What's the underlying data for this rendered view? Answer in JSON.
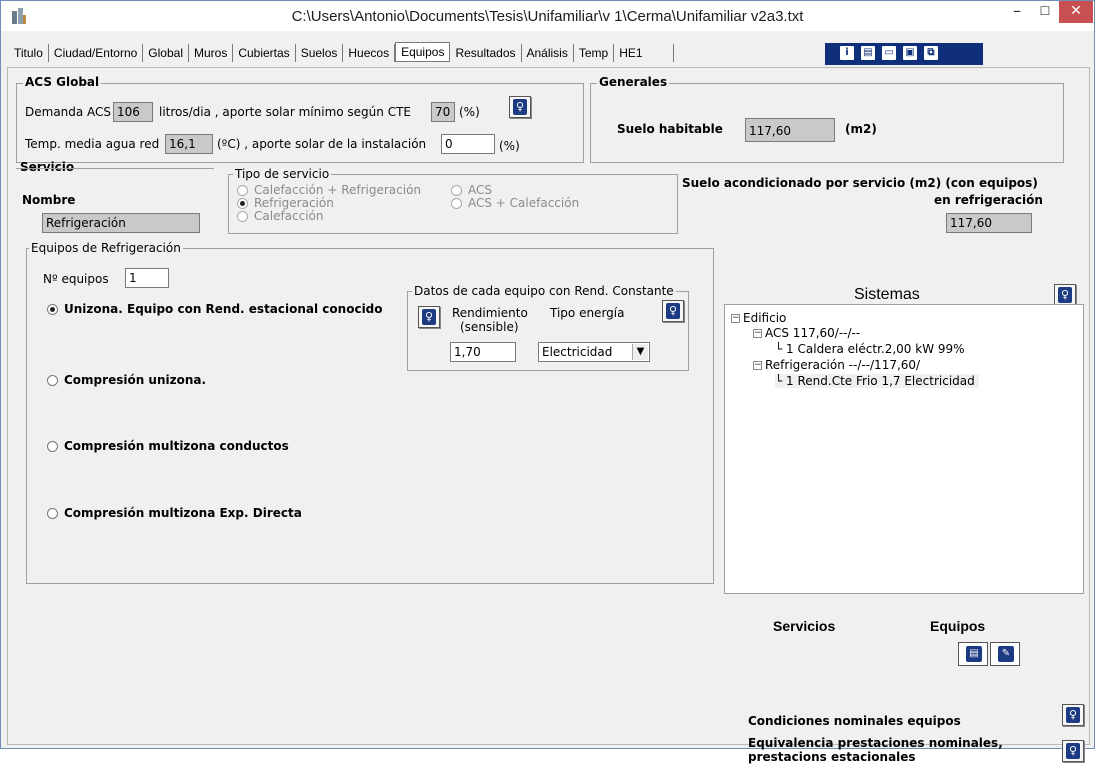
{
  "window": {
    "title": "C:\\Users\\Antonio\\Documents\\Tesis\\Unifamiliar\\v 1\\Cerma\\Unifamiliar v2a3.txt",
    "minimize": "–",
    "maximize": "☐",
    "close": "✕"
  },
  "tabs": [
    {
      "label": "Titulo"
    },
    {
      "label": "Ciudad/Entorno"
    },
    {
      "label": "Global"
    },
    {
      "label": "Muros"
    },
    {
      "label": "Cubiertas"
    },
    {
      "label": "Suelos"
    },
    {
      "label": "Huecos"
    },
    {
      "label": "Equipos"
    },
    {
      "label": "Resultados"
    },
    {
      "label": "Análisis"
    },
    {
      "label": "Temp"
    },
    {
      "label": "HE1"
    }
  ],
  "active_tab": "Equipos",
  "toolbar": {
    "icons": [
      "info-icon",
      "document-icon",
      "folder-open-icon",
      "save-icon",
      "copy-icon"
    ],
    "color": "#0f2f7a"
  },
  "acs_global": {
    "legend": "ACS Global",
    "demanda_label": "Demanda ACS",
    "demanda_value": "106",
    "demanda_unit": "litros/dia , aporte solar mínimo según CTE",
    "aporte_min_value": "70",
    "aporte_min_unit": "(%)",
    "temp_label": "Temp. media agua red",
    "temp_value": "16,1",
    "temp_unit": "(ºC) , aporte solar de la instalación",
    "aporte_inst_value": "0",
    "aporte_inst_unit": "(%)"
  },
  "generales": {
    "legend": "Generales",
    "suelo_label": "Suelo habitable",
    "suelo_value": "117,60",
    "suelo_unit": "(m2)"
  },
  "servicio": {
    "legend": "Servicio",
    "nombre_label": "Nombre",
    "nombre_value": "Refrigeración",
    "tipo_legend": "Tipo de servicio",
    "tipos": [
      {
        "label": "Calefacción + Refrigeración",
        "checked": false
      },
      {
        "label": "ACS",
        "checked": false
      },
      {
        "label": "Refrigeración",
        "checked": true
      },
      {
        "label": "ACS + Calefacción",
        "checked": false
      },
      {
        "label": "Calefacción",
        "checked": false
      }
    ],
    "suelo_acond_label1": "Suelo acondicionado por servicio (m2)  (con equipos)",
    "suelo_acond_label2": "en refrigeración",
    "suelo_acond_value": "117,60"
  },
  "equipos_refrig": {
    "legend": "Equipos de Refrigeración",
    "num_label": "Nº equipos",
    "num_value": "1",
    "options": [
      {
        "label": "Unizona. Equipo con Rend. estacional conocido",
        "checked": true
      },
      {
        "label": "Compresión unizona.",
        "checked": false
      },
      {
        "label": "Compresión multizona conductos",
        "checked": false
      },
      {
        "label": "Compresión multizona Exp. Directa",
        "checked": false
      }
    ],
    "datos_legend": "Datos de cada equipo con Rend. Constante",
    "rend_label1": "Rendimiento",
    "rend_label2": "(sensible)",
    "tipo_energia_label": "Tipo energía",
    "rend_value": "1,70",
    "energia_value": "Electricidad"
  },
  "sistemas": {
    "title": "Sistemas",
    "tree": [
      {
        "label": "Edificio",
        "expander": "−"
      },
      {
        "label": "ACS 117,60/--/--",
        "expander": "−"
      },
      {
        "label": "1 Caldera eléctr.2,00 kW 99%",
        "expander": ""
      },
      {
        "label": "Refrigeración --/--/117,60/",
        "expander": "−"
      },
      {
        "label": "1 Rend.Cte Frio 1,7 Electricidad",
        "expander": ""
      }
    ]
  },
  "bottom": {
    "servicios_label": "Servicios",
    "equipos_label": "Equipos",
    "cond_nominales": "Condiciones nominales equipos",
    "equiv_line1": "Equivalencia prestaciones nominales,",
    "equiv_line2": "prestacions estacionales"
  }
}
